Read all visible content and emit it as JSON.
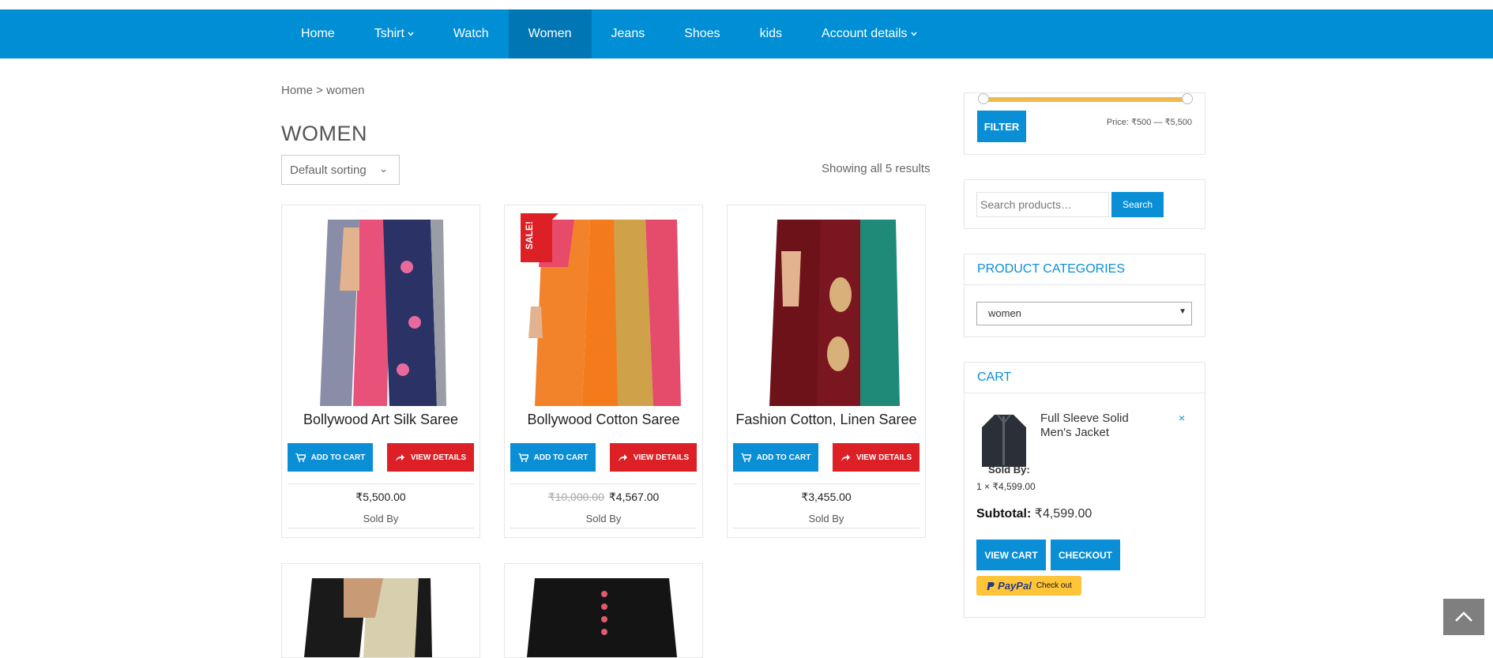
{
  "nav": {
    "items": [
      {
        "label": "Home",
        "has_caret": false,
        "active": false
      },
      {
        "label": "Tshirt",
        "has_caret": true,
        "active": false
      },
      {
        "label": "Watch",
        "has_caret": false,
        "active": false
      },
      {
        "label": "Women",
        "has_caret": false,
        "active": true
      },
      {
        "label": "Jeans",
        "has_caret": false,
        "active": false
      },
      {
        "label": "Shoes",
        "has_caret": false,
        "active": false
      },
      {
        "label": "kids",
        "has_caret": false,
        "active": false
      },
      {
        "label": "Account details",
        "has_caret": true,
        "active": false
      }
    ],
    "color": "#008fd5",
    "active_color": "#0077b4"
  },
  "breadcrumb": "Home > women",
  "page_title": "WOMEN",
  "sorting": {
    "selected": "Default sorting"
  },
  "result_count": "Showing all 5 results",
  "products": [
    {
      "title": "Bollywood Art Silk Saree",
      "add_label": "ADD TO CART",
      "view_label": "VIEW DETAILS",
      "price": "₹5,500.00",
      "old_price": "",
      "sold_by": "Sold By",
      "sale": false
    },
    {
      "title": "Bollywood Cotton Saree",
      "add_label": "ADD TO CART",
      "view_label": "VIEW DETAILS",
      "price": "₹4,567.00",
      "old_price": "₹10,000.00",
      "sold_by": "Sold By",
      "sale": true,
      "sale_label": "SALE!"
    },
    {
      "title": "Fashion Cotton, Linen Saree",
      "add_label": "ADD TO CART",
      "view_label": "VIEW DETAILS",
      "price": "₹3,455.00",
      "old_price": "",
      "sold_by": "Sold By",
      "sale": false
    }
  ],
  "sidebar": {
    "price_filter": {
      "button": "FILTER",
      "label": "Price: ₹500 — ₹5,500",
      "min": 500,
      "max": 5500
    },
    "search": {
      "placeholder": "Search products…",
      "button": "Search"
    },
    "categories": {
      "title": "PRODUCT CATEGORIES",
      "selected": "women"
    },
    "cart": {
      "title": "CART",
      "item_name": "Full Sleeve Solid Men's Jacket",
      "remove": "×",
      "sold_by": "Sold By:",
      "qty": "1 × ₹4,599.00",
      "subtotal_label": "Subtotal:",
      "subtotal_value": "₹4,599.00",
      "view_cart": "VIEW CART",
      "checkout": "CHECKOUT",
      "paypal_brand": "PayPal",
      "paypal_text": "Check out"
    }
  },
  "colors": {
    "primary": "#0a8fd6",
    "danger": "#dd1f26",
    "slider": "#f1b84c"
  }
}
